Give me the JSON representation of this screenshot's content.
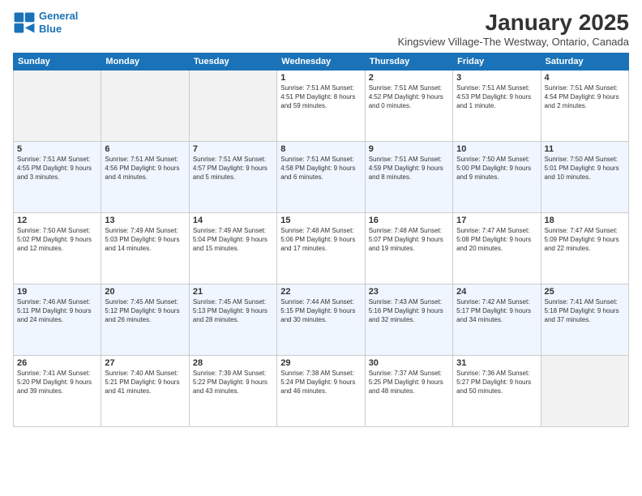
{
  "header": {
    "logo_line1": "General",
    "logo_line2": "Blue",
    "title": "January 2025",
    "subtitle": "Kingsview Village-The Westway, Ontario, Canada"
  },
  "days_of_week": [
    "Sunday",
    "Monday",
    "Tuesday",
    "Wednesday",
    "Thursday",
    "Friday",
    "Saturday"
  ],
  "weeks": [
    [
      {
        "num": "",
        "info": ""
      },
      {
        "num": "",
        "info": ""
      },
      {
        "num": "",
        "info": ""
      },
      {
        "num": "1",
        "info": "Sunrise: 7:51 AM\nSunset: 4:51 PM\nDaylight: 8 hours and 59 minutes."
      },
      {
        "num": "2",
        "info": "Sunrise: 7:51 AM\nSunset: 4:52 PM\nDaylight: 9 hours and 0 minutes."
      },
      {
        "num": "3",
        "info": "Sunrise: 7:51 AM\nSunset: 4:53 PM\nDaylight: 9 hours and 1 minute."
      },
      {
        "num": "4",
        "info": "Sunrise: 7:51 AM\nSunset: 4:54 PM\nDaylight: 9 hours and 2 minutes."
      }
    ],
    [
      {
        "num": "5",
        "info": "Sunrise: 7:51 AM\nSunset: 4:55 PM\nDaylight: 9 hours and 3 minutes."
      },
      {
        "num": "6",
        "info": "Sunrise: 7:51 AM\nSunset: 4:56 PM\nDaylight: 9 hours and 4 minutes."
      },
      {
        "num": "7",
        "info": "Sunrise: 7:51 AM\nSunset: 4:57 PM\nDaylight: 9 hours and 5 minutes."
      },
      {
        "num": "8",
        "info": "Sunrise: 7:51 AM\nSunset: 4:58 PM\nDaylight: 9 hours and 6 minutes."
      },
      {
        "num": "9",
        "info": "Sunrise: 7:51 AM\nSunset: 4:59 PM\nDaylight: 9 hours and 8 minutes."
      },
      {
        "num": "10",
        "info": "Sunrise: 7:50 AM\nSunset: 5:00 PM\nDaylight: 9 hours and 9 minutes."
      },
      {
        "num": "11",
        "info": "Sunrise: 7:50 AM\nSunset: 5:01 PM\nDaylight: 9 hours and 10 minutes."
      }
    ],
    [
      {
        "num": "12",
        "info": "Sunrise: 7:50 AM\nSunset: 5:02 PM\nDaylight: 9 hours and 12 minutes."
      },
      {
        "num": "13",
        "info": "Sunrise: 7:49 AM\nSunset: 5:03 PM\nDaylight: 9 hours and 14 minutes."
      },
      {
        "num": "14",
        "info": "Sunrise: 7:49 AM\nSunset: 5:04 PM\nDaylight: 9 hours and 15 minutes."
      },
      {
        "num": "15",
        "info": "Sunrise: 7:48 AM\nSunset: 5:06 PM\nDaylight: 9 hours and 17 minutes."
      },
      {
        "num": "16",
        "info": "Sunrise: 7:48 AM\nSunset: 5:07 PM\nDaylight: 9 hours and 19 minutes."
      },
      {
        "num": "17",
        "info": "Sunrise: 7:47 AM\nSunset: 5:08 PM\nDaylight: 9 hours and 20 minutes."
      },
      {
        "num": "18",
        "info": "Sunrise: 7:47 AM\nSunset: 5:09 PM\nDaylight: 9 hours and 22 minutes."
      }
    ],
    [
      {
        "num": "19",
        "info": "Sunrise: 7:46 AM\nSunset: 5:11 PM\nDaylight: 9 hours and 24 minutes."
      },
      {
        "num": "20",
        "info": "Sunrise: 7:45 AM\nSunset: 5:12 PM\nDaylight: 9 hours and 26 minutes."
      },
      {
        "num": "21",
        "info": "Sunrise: 7:45 AM\nSunset: 5:13 PM\nDaylight: 9 hours and 28 minutes."
      },
      {
        "num": "22",
        "info": "Sunrise: 7:44 AM\nSunset: 5:15 PM\nDaylight: 9 hours and 30 minutes."
      },
      {
        "num": "23",
        "info": "Sunrise: 7:43 AM\nSunset: 5:16 PM\nDaylight: 9 hours and 32 minutes."
      },
      {
        "num": "24",
        "info": "Sunrise: 7:42 AM\nSunset: 5:17 PM\nDaylight: 9 hours and 34 minutes."
      },
      {
        "num": "25",
        "info": "Sunrise: 7:41 AM\nSunset: 5:18 PM\nDaylight: 9 hours and 37 minutes."
      }
    ],
    [
      {
        "num": "26",
        "info": "Sunrise: 7:41 AM\nSunset: 5:20 PM\nDaylight: 9 hours and 39 minutes."
      },
      {
        "num": "27",
        "info": "Sunrise: 7:40 AM\nSunset: 5:21 PM\nDaylight: 9 hours and 41 minutes."
      },
      {
        "num": "28",
        "info": "Sunrise: 7:39 AM\nSunset: 5:22 PM\nDaylight: 9 hours and 43 minutes."
      },
      {
        "num": "29",
        "info": "Sunrise: 7:38 AM\nSunset: 5:24 PM\nDaylight: 9 hours and 46 minutes."
      },
      {
        "num": "30",
        "info": "Sunrise: 7:37 AM\nSunset: 5:25 PM\nDaylight: 9 hours and 48 minutes."
      },
      {
        "num": "31",
        "info": "Sunrise: 7:36 AM\nSunset: 5:27 PM\nDaylight: 9 hours and 50 minutes."
      },
      {
        "num": "",
        "info": ""
      }
    ]
  ]
}
